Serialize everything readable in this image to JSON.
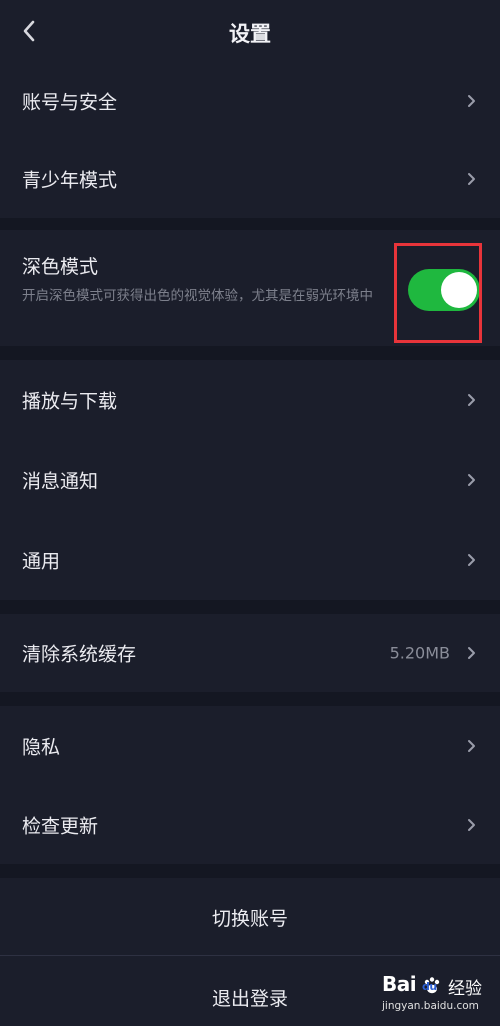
{
  "header": {
    "title": "设置",
    "back_icon": "chevron-left-icon"
  },
  "groups": {
    "account": [
      {
        "label": "账号与安全"
      },
      {
        "label": "青少年模式"
      }
    ],
    "dark_mode": {
      "label": "深色模式",
      "description": "开启深色模式可获得出色的视觉体验，尤其是在弱光环境中",
      "enabled": true,
      "toggle_color": "#1fb83f",
      "highlight_color": "#e8343a"
    },
    "media": [
      {
        "label": "播放与下载"
      },
      {
        "label": "消息通知"
      },
      {
        "label": "通用"
      }
    ],
    "cache": {
      "label": "清除系统缓存",
      "value": "5.20MB"
    },
    "misc": [
      {
        "label": "隐私"
      },
      {
        "label": "检查更新"
      }
    ]
  },
  "actions": {
    "switch_account": "切换账号",
    "logout": "退出登录"
  },
  "watermark": {
    "logo_text": "Bai",
    "logo_suffix": "du",
    "brand": "经验",
    "url": "jingyan.baidu.com"
  },
  "colors": {
    "background": "#141722",
    "panel": "#1b1e2b",
    "text": "#ebebf0",
    "subtext": "#7d808c"
  }
}
